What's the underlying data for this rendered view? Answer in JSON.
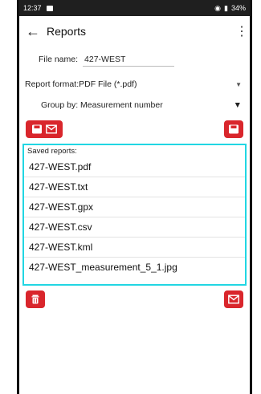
{
  "statusbar": {
    "time": "12:37",
    "battery": "34%"
  },
  "header": {
    "title": "Reports"
  },
  "form": {
    "filename_label": "File name:",
    "filename_value": "427-WEST",
    "format_text": "Report format:PDF File (*.pdf)",
    "group_text": "Group by: Measurement number"
  },
  "saved": {
    "header": "Saved reports:",
    "items": [
      "427-WEST.pdf",
      "427-WEST.txt",
      "427-WEST.gpx",
      "427-WEST.csv",
      "427-WEST.kml",
      "427-WEST_measurement_5_1.jpg"
    ]
  },
  "colors": {
    "accent": "#d9262c",
    "highlight": "#21d6e3"
  },
  "icons": {
    "save": "save-icon",
    "mail": "mail-icon",
    "delete": "trash-icon",
    "back": "back-arrow-icon",
    "menu": "kebab-icon"
  }
}
